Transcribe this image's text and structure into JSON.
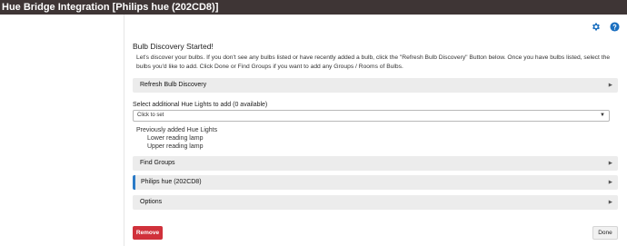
{
  "window": {
    "title": "Hue Bridge Integration [Philips hue (202CD8)]"
  },
  "icons": {
    "settings": "gear-icon",
    "help": "help-icon"
  },
  "colors": {
    "title_bar": "#3e3535",
    "section_bg": "#ececec",
    "active_accent": "#2b7bc7",
    "remove_button": "#d0313b",
    "icon_blue": "#1a6fc0"
  },
  "discovery": {
    "heading": "Bulb Discovery Started!",
    "intro": "Let's discover your bulbs.  If you don't see any bulbs listed or have recently added a bulb, click the \"Refresh Bulb Discovery\" Button below.  Once you have bulbs listed, select the bulbs you'd like to add. Click Done or Find Groups if you want to add any Groups / Rooms of Bulbs."
  },
  "sections": {
    "refresh": "Refresh Bulb Discovery",
    "find_groups": "Find Groups",
    "bridge": "Philips hue  (202CD8)",
    "options": "Options"
  },
  "select": {
    "label": "Select additional Hue Lights to add (0 available)",
    "value": "Click to set"
  },
  "previous": {
    "heading": "Previously added Hue Lights",
    "items": [
      "Lower reading lamp",
      "Upper reading lamp"
    ]
  },
  "buttons": {
    "remove": "Remove",
    "done": "Done"
  }
}
